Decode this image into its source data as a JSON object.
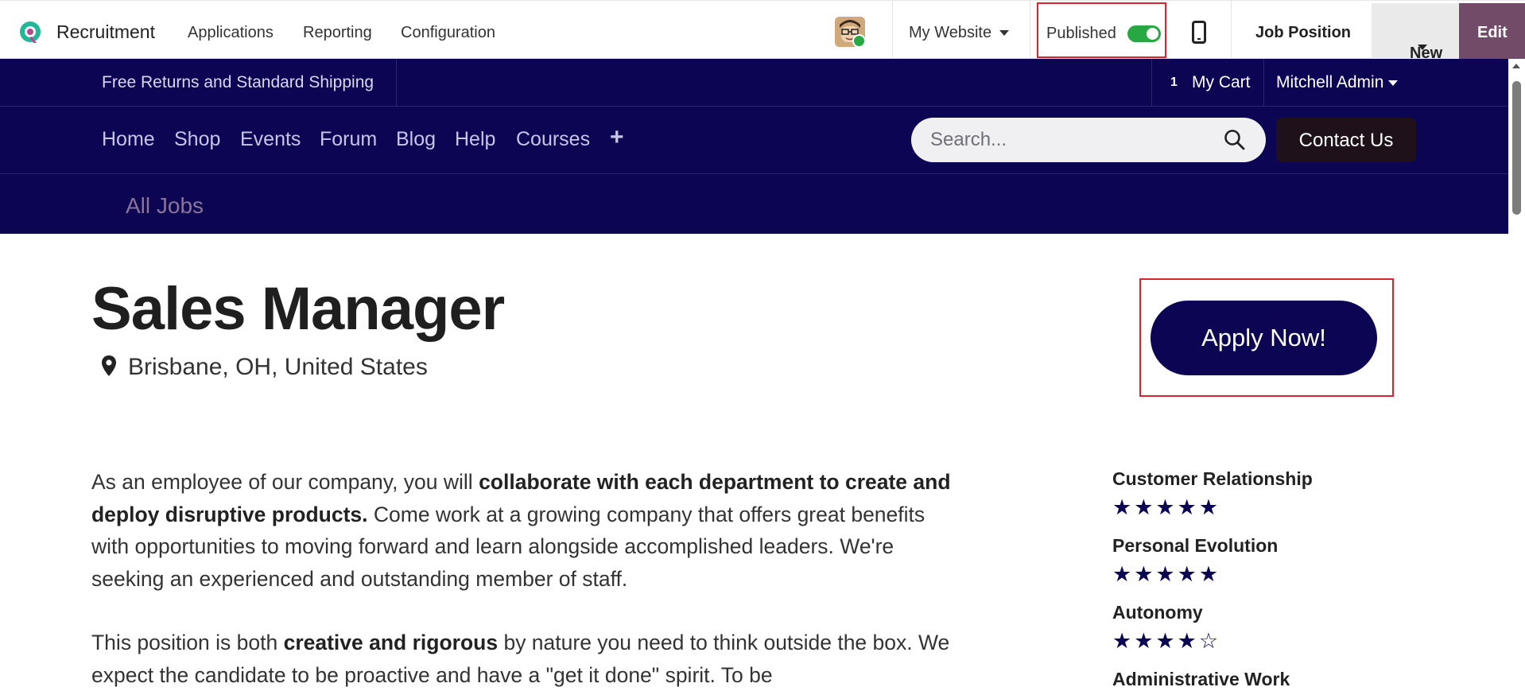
{
  "topbar": {
    "app_name": "Recruitment",
    "menus": [
      "Applications",
      "Reporting",
      "Configuration"
    ],
    "website_selector": "My Website",
    "published_label": "Published",
    "published": true,
    "job_position": "Job Position",
    "new_label": "New",
    "edit_label": "Edit"
  },
  "promo": {
    "text": "Free Returns and Standard Shipping",
    "cart_count": "1",
    "cart_label": "My Cart",
    "user": "Mitchell Admin"
  },
  "nav": {
    "links": [
      "Home",
      "Shop",
      "Events",
      "Forum",
      "Blog",
      "Help",
      "Courses"
    ],
    "plus": "+",
    "search_placeholder": "Search...",
    "contact": "Contact Us"
  },
  "subnav": {
    "all_jobs": "All Jobs"
  },
  "job": {
    "title": "Sales Manager",
    "location": "Brisbane, OH, United States",
    "apply": "Apply Now!"
  },
  "description": {
    "p1": [
      "As an employee of our company, you will ",
      "collaborate with each department to create and deploy disruptive products.",
      " Come work at a growing company that offers great benefits with opportunities to moving forward and learn alongside accomplished leaders. We're seeking an experienced and outstanding member of staff."
    ],
    "p2": [
      "This position is both ",
      "creative and rigorous",
      " by nature you need to think outside the box. We expect the candidate to be proactive and have a \"get it done\" spirit. To be"
    ]
  },
  "ratings": [
    {
      "name": "Customer Relationship",
      "stars": "★★★★★"
    },
    {
      "name": "Personal Evolution",
      "stars": "★★★★★"
    },
    {
      "name": "Autonomy",
      "stars": "★★★★☆"
    },
    {
      "name": "Administrative Work",
      "stars": ""
    }
  ],
  "colors": {
    "brand_navy": "#0b0554",
    "odoo_purple": "#714b67",
    "highlight_red": "#d9242e",
    "toggle_green": "#28a745"
  }
}
